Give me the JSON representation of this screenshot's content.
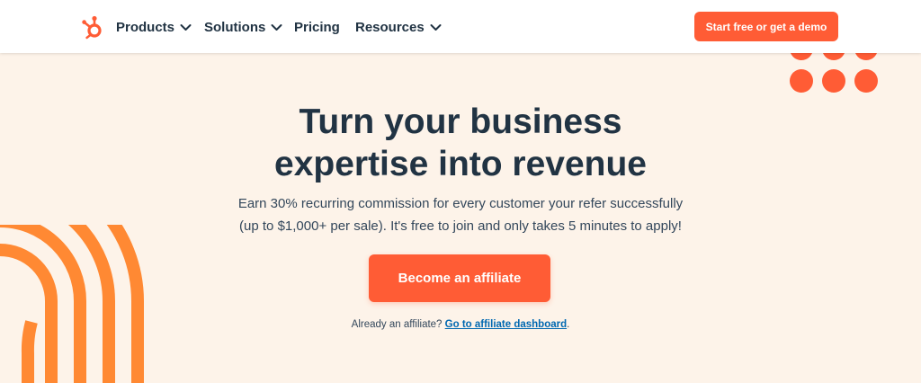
{
  "colors": {
    "accent": "#ff5c35",
    "heading": "#213343",
    "body_text": "#33475b",
    "background": "#fdf3e9",
    "link": "#0068b1",
    "decor_orange": "#ff8933"
  },
  "header": {
    "logo_icon": "hubspot-sprocket-icon",
    "nav": [
      {
        "label": "Products",
        "has_dropdown": true
      },
      {
        "label": "Solutions",
        "has_dropdown": true
      },
      {
        "label": "Pricing",
        "has_dropdown": false
      },
      {
        "label": "Resources",
        "has_dropdown": true
      }
    ],
    "cta_label": "Start free or get a demo"
  },
  "hero": {
    "title_line1": "Turn your business",
    "title_line2": "expertise into revenue",
    "text_line1": "Earn 30% recurring commission for every customer your refer successfully",
    "text_line2": "(up to $1,000+ per sale). It's free to join and only takes 5 minutes to apply!",
    "button_label": "Become an affiliate",
    "footnote_prefix": "Already an affiliate? ",
    "footnote_link": "Go to affiliate dashboard",
    "footnote_suffix": "."
  }
}
